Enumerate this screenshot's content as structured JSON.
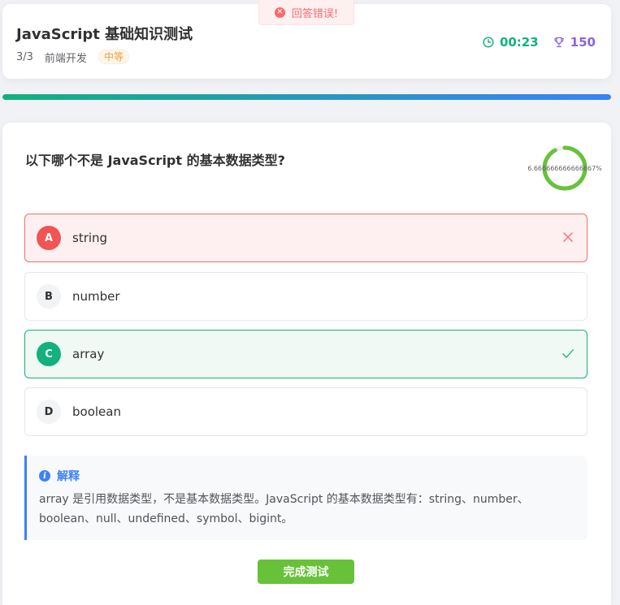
{
  "header": {
    "title": "JavaScript 基础知识测试",
    "progress": "3/3",
    "category": "前端开发",
    "difficulty": "中等",
    "timer": "00:23",
    "score": "150"
  },
  "toast": {
    "message": "回答错误!",
    "icon": "close-circle-icon",
    "color": "#f56c6c"
  },
  "progress_bar": {
    "fraction": 1.0,
    "gradient": [
      "#13b17d",
      "#3b82f6"
    ]
  },
  "question": {
    "text": "以下哪个不是 JavaScript 的基本数据类型?",
    "ring_percent_label": "6.666666666666667%",
    "ring_fraction": 0.92,
    "ring_color": "#67c23a"
  },
  "options": [
    {
      "letter": "A",
      "text": "string",
      "state": "wrong"
    },
    {
      "letter": "B",
      "text": "number",
      "state": "none"
    },
    {
      "letter": "C",
      "text": "array",
      "state": "correct"
    },
    {
      "letter": "D",
      "text": "boolean",
      "state": "none"
    }
  ],
  "explanation": {
    "title": "解释",
    "body": "array 是引用数据类型，不是基本数据类型。JavaScript 的基本数据类型有：string、number、boolean、null、undefined、symbol、bigint。"
  },
  "actions": {
    "finish_label": "完成测试"
  },
  "colors": {
    "wrong": "#f56c6c",
    "correct": "#13b17d",
    "accent": "#3b82f6",
    "success_button": "#67c23a"
  }
}
